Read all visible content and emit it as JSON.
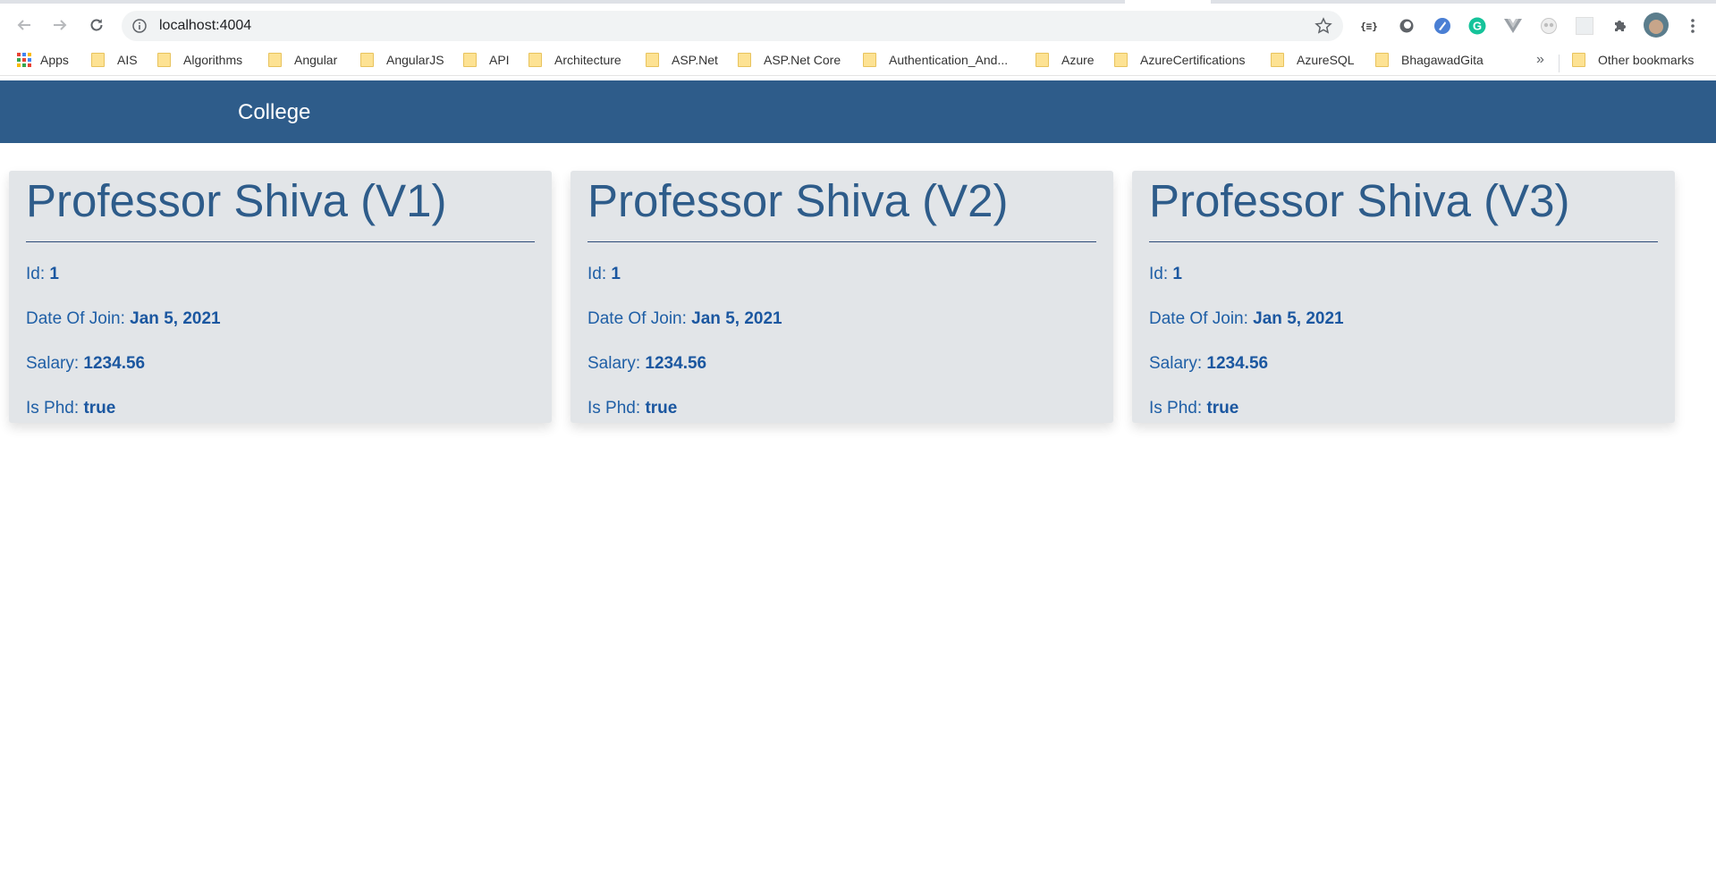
{
  "browser": {
    "url": "localhost:4004",
    "bookmarks": {
      "apps": "Apps",
      "items": [
        "AIS",
        "Algorithms",
        "Angular",
        "AngularJS",
        "API",
        "Architecture",
        "ASP.Net",
        "ASP.Net Core",
        "Authentication_And...",
        "Azure",
        "AzureCertifications",
        "AzureSQL",
        "BhagawadGita"
      ],
      "overflow": "»",
      "other": "Other bookmarks"
    },
    "icons": [
      "back-arrow-icon",
      "forward-arrow-icon",
      "reload-icon",
      "info-icon",
      "star-icon",
      "json-viewer-icon",
      "circle-extension-icon",
      "blue-extension-icon",
      "grammarly-icon",
      "vue-icon",
      "owl-extension-icon",
      "blank-extension-icon",
      "puzzle-icon",
      "avatar",
      "more-vert-icon"
    ]
  },
  "header": {
    "brand": "College"
  },
  "labels": {
    "id": "Id:",
    "date_of_join": "Date Of Join:",
    "salary": "Salary:",
    "is_phd": "Is Phd:"
  },
  "cards": [
    {
      "title": "Professor Shiva (V1)",
      "id": "1",
      "date_of_join": "Jan 5, 2021",
      "salary": "1234.56",
      "is_phd": "true"
    },
    {
      "title": "Professor Shiva (V2)",
      "id": "1",
      "date_of_join": "Jan 5, 2021",
      "salary": "1234.56",
      "is_phd": "true"
    },
    {
      "title": "Professor Shiva (V3)",
      "id": "1",
      "date_of_join": "Jan 5, 2021",
      "salary": "1234.56",
      "is_phd": "true"
    }
  ],
  "colors": {
    "header_bg": "#2e5c8a",
    "card_bg": "#e2e5e8",
    "value_text": "#1b57a0"
  }
}
